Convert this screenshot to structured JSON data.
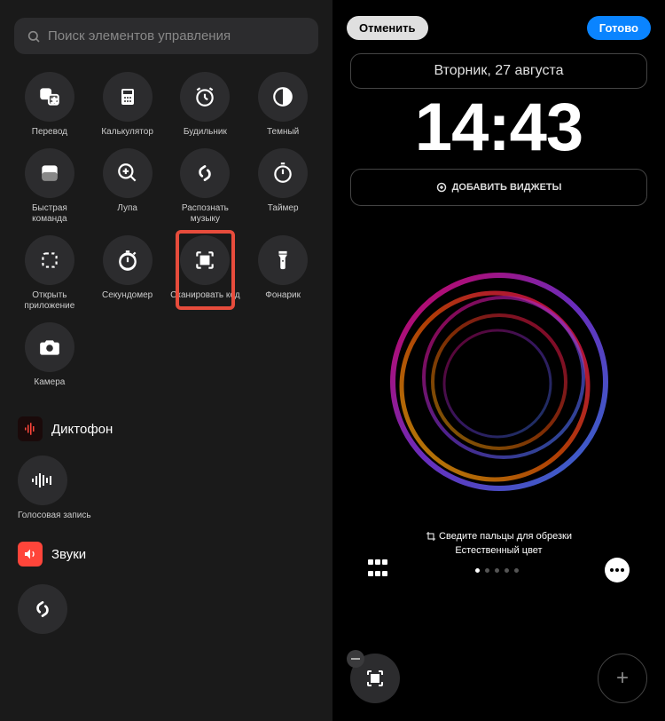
{
  "search": {
    "placeholder": "Поиск элементов управления"
  },
  "controls": [
    {
      "id": "translate",
      "label": "Перевод"
    },
    {
      "id": "calculator",
      "label": "Калькулятор"
    },
    {
      "id": "alarm",
      "label": "Будильник"
    },
    {
      "id": "dark",
      "label": "Темный"
    },
    {
      "id": "shortcut",
      "label": "Быстрая команда"
    },
    {
      "id": "magnifier",
      "label": "Лупа"
    },
    {
      "id": "shazam",
      "label": "Распознать музыку"
    },
    {
      "id": "timer",
      "label": "Таймер"
    },
    {
      "id": "open-app",
      "label": "Открыть приложение"
    },
    {
      "id": "stopwatch",
      "label": "Секундомер"
    },
    {
      "id": "scan-code",
      "label": "Сканировать код",
      "highlighted": true
    },
    {
      "id": "flashlight",
      "label": "Фонарик"
    },
    {
      "id": "camera",
      "label": "Камера"
    }
  ],
  "sections": {
    "voice_memos": "Диктофон",
    "voice_record": "Голосовая запись",
    "sounds": "Звуки"
  },
  "lockscreen": {
    "cancel": "Отменить",
    "done": "Готово",
    "date": "Вторник, 27 августа",
    "time": "14:43",
    "add_widgets": "ДОБАВИТЬ ВИДЖЕТЫ",
    "crop_hint": "Сведите пальцы для обрезки",
    "color_mode": "Естественный цвет"
  }
}
